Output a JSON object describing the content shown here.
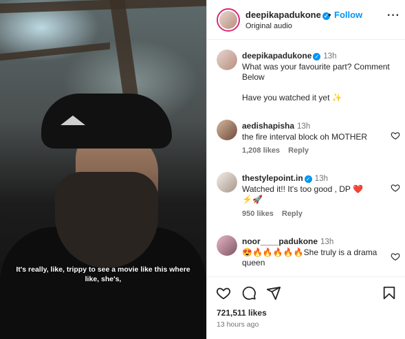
{
  "video": {
    "caption": "It's really, like, trippy to see a movie like this where like, she's,"
  },
  "header": {
    "username": "deepikapadukone",
    "verified": "✓",
    "separator": "•",
    "follow_label": "Follow",
    "subtitle": "Original audio",
    "more_label": "···"
  },
  "comments": [
    {
      "username": "deepikapadukone",
      "time": "13h",
      "text": "What was your favourite part? Comment Below",
      "text2": "Have you watched it yet ✨",
      "verified": true
    },
    {
      "username": "aedishapisha",
      "time": "13h",
      "text": "the fire interval block oh MOTHER",
      "likes": "1,208 likes",
      "reply": "Reply"
    },
    {
      "username": "thestylepoint.in",
      "time": "13h",
      "text": "Watched it!! It's too good , DP ❤️",
      "text2": "⚡🚀",
      "likes": "950 likes",
      "reply": "Reply",
      "verified": true
    },
    {
      "username": "noor____padukone",
      "time": "13h",
      "text": "😍🔥🔥🔥🔥🔥She truly is a drama queen",
      "likes": "",
      "reply": ""
    }
  ],
  "actions": {
    "likes_count": "721,511 likes",
    "posted_ago": "13 hours ago"
  }
}
